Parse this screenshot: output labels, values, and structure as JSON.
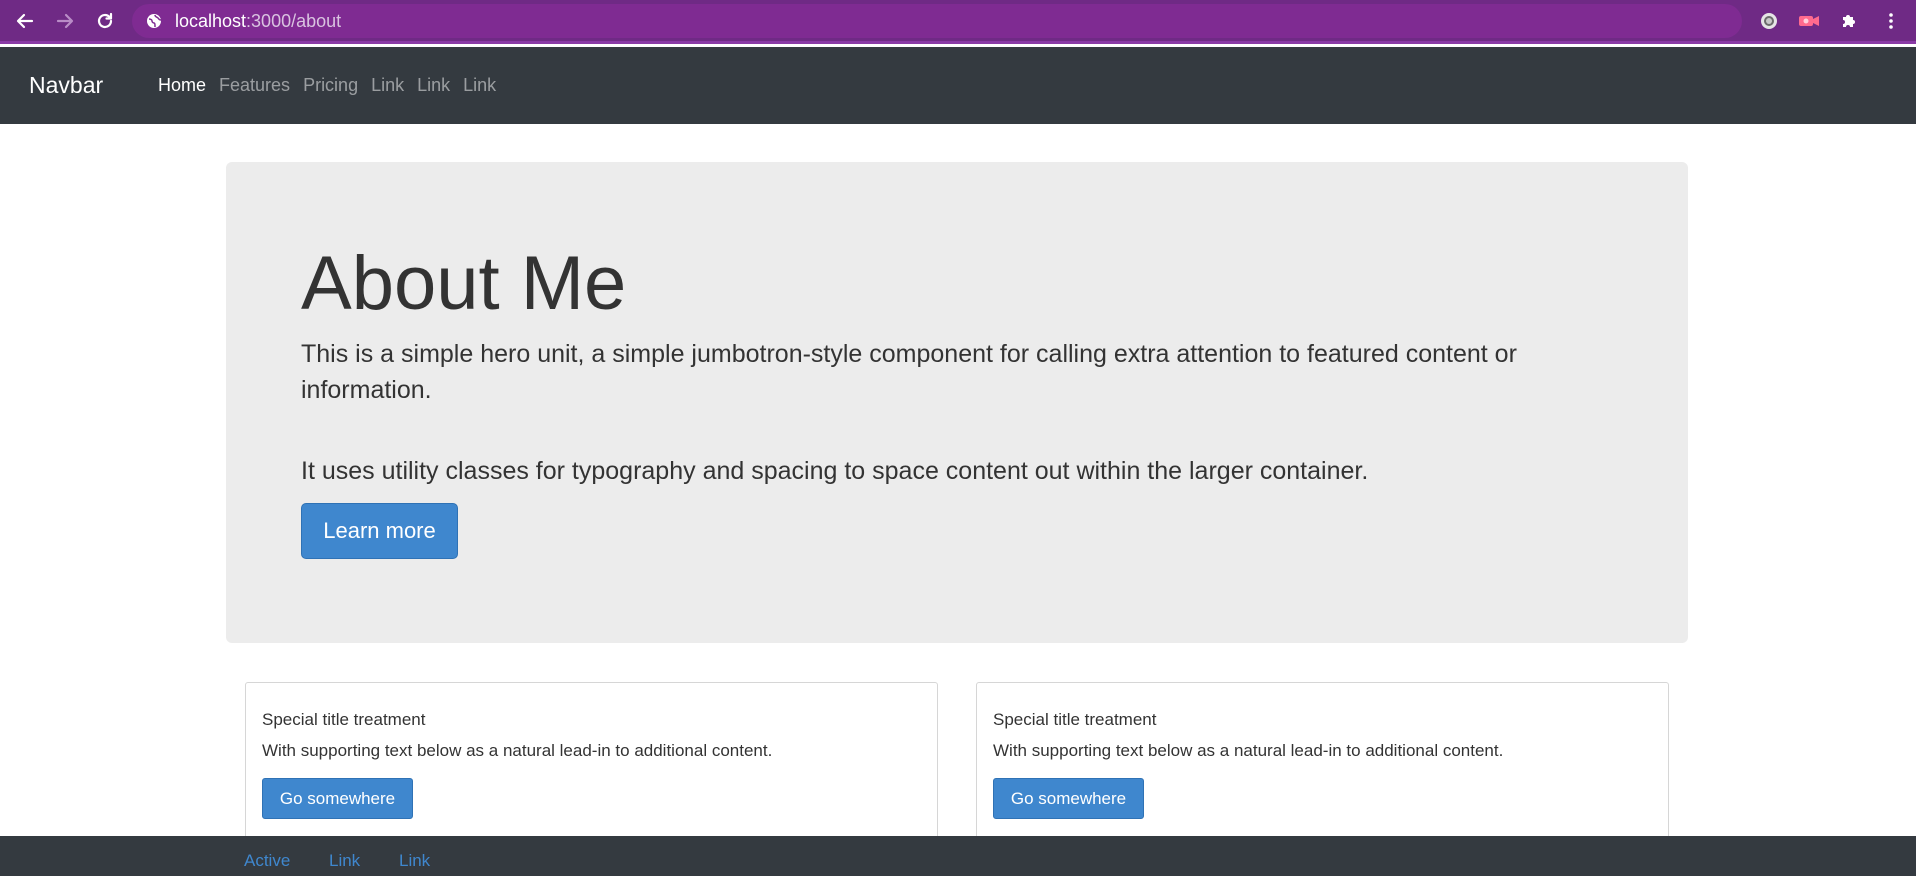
{
  "browser": {
    "url_host": "localhost",
    "url_path": ":3000/about"
  },
  "navbar": {
    "brand": "Navbar",
    "links": [
      "Home",
      "Features",
      "Pricing",
      "Link",
      "Link",
      "Link"
    ],
    "active_index": 0
  },
  "jumbotron": {
    "title": "About Me",
    "lead": "This is a simple hero unit, a simple jumbotron-style component for calling extra attention to featured content or information.",
    "body": "It uses utility classes for typography and spacing to space content out within the larger container.",
    "button_label": "Learn more"
  },
  "cards": [
    {
      "title": "Special title treatment",
      "text": "With supporting text below as a natural lead-in to additional content.",
      "button_label": "Go somewhere"
    },
    {
      "title": "Special title treatment",
      "text": "With supporting text below as a natural lead-in to additional content.",
      "button_label": "Go somewhere"
    }
  ],
  "footer": {
    "links": [
      "Active",
      "Link",
      "Link"
    ]
  },
  "colors": {
    "chrome": "#6f2a85",
    "navbar": "#343a40",
    "jumbotron_bg": "#ececec",
    "primary": "#3f87ce"
  }
}
